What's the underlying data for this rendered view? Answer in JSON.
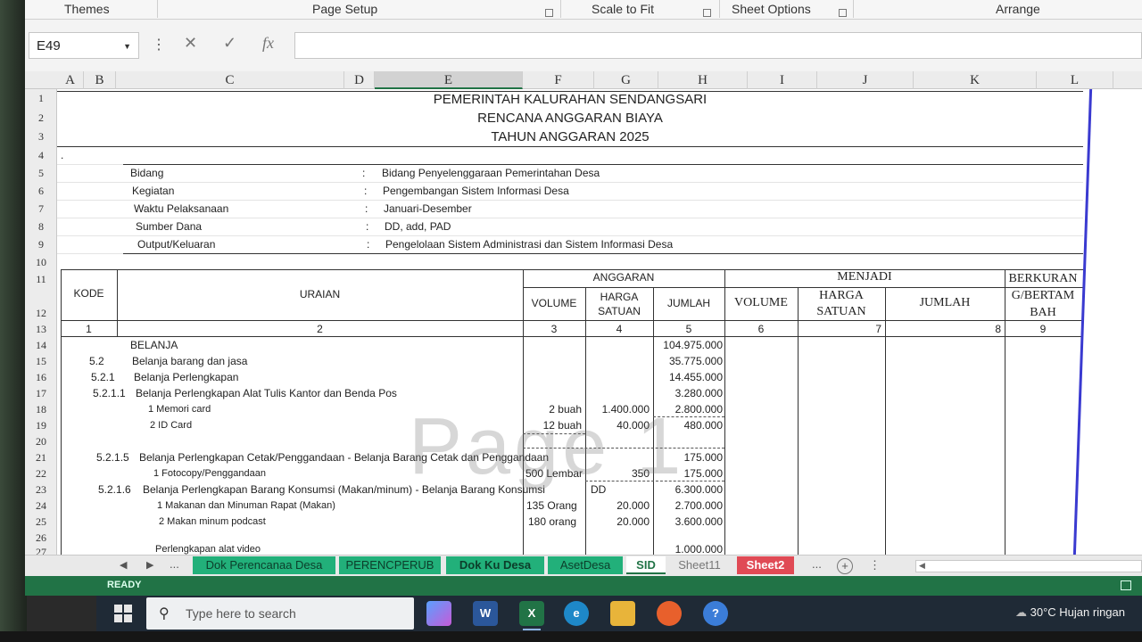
{
  "ribbon": {
    "groups": [
      "Themes",
      "Page Setup",
      "Scale to Fit",
      "Sheet Options",
      "Arrange"
    ]
  },
  "formula_bar": {
    "name_box": "E49",
    "dots": "⋮",
    "cancel": "✕",
    "enter": "✓",
    "fx": "fx",
    "value": ""
  },
  "columns": [
    "A",
    "B",
    "C",
    "D",
    "E",
    "F",
    "G",
    "H",
    "I",
    "J",
    "K",
    "L"
  ],
  "selected_column": "E",
  "rows": [
    "1",
    "2",
    "3",
    "4",
    "5",
    "6",
    "7",
    "8",
    "9",
    "10",
    "11",
    "12",
    "13",
    "14",
    "15",
    "16",
    "17",
    "18",
    "19",
    "20",
    "21",
    "22",
    "23",
    "24",
    "25",
    "26",
    "27"
  ],
  "title": {
    "line1": "PEMERINTAH KALURAHAN SENDANGSARI",
    "line2": "RENCANA ANGGARAN BIAYA",
    "line3": "TAHUN ANGGARAN 2025"
  },
  "row4_mark": ".",
  "info": [
    {
      "label": "Bidang",
      "sep": ":",
      "value": "Bidang Penyelenggaraan Pemerintahan Desa"
    },
    {
      "label": "Kegiatan",
      "sep": ":",
      "value": "Pengembangan Sistem Informasi Desa"
    },
    {
      "label": "Waktu Pelaksanaan",
      "sep": ":",
      "value": "Januari-Desember"
    },
    {
      "label": "Sumber Dana",
      "sep": ":",
      "value": "DD, add, PAD"
    },
    {
      "label": "Output/Keluaran",
      "sep": ":",
      "value": "Pengelolaan Sistem Administrasi dan Sistem Informasi Desa"
    }
  ],
  "headers": {
    "kode": "KODE",
    "uraian": "URAIAN",
    "anggaran": "ANGGARAN",
    "volume": "VOLUME",
    "harga_satuan_1": "HARGA",
    "harga_satuan_2": "SATUAN",
    "jumlah": "JUMLAH",
    "menjadi": "MENJADI",
    "volume2": "VOLUME",
    "harga2_1": "HARGA",
    "harga2_2": "SATUAN",
    "jumlah2": "JUMLAH",
    "berkurang_1": "BERKURAN",
    "berkurang_2": "G/BERTAM",
    "berkurang_3": "BAH"
  },
  "col_numbers": [
    "1",
    "2",
    "3",
    "4",
    "5",
    "6",
    "7",
    "8",
    "9"
  ],
  "items": [
    {
      "kode": "",
      "uraian": "BELANJA",
      "volume": "",
      "harga": "",
      "jumlah": "104.975.000"
    },
    {
      "kode": "5.2",
      "uraian": "Belanja barang dan jasa",
      "volume": "",
      "harga": "",
      "jumlah": "35.775.000"
    },
    {
      "kode": "5.2.1",
      "uraian": "Belanja Perlengkapan",
      "volume": "",
      "harga": "",
      "jumlah": "14.455.000"
    },
    {
      "kode": "5.2.1.1",
      "uraian": "Belanja Perlengkapan Alat Tulis Kantor dan Benda Pos",
      "volume": "",
      "harga": "",
      "jumlah": "3.280.000"
    },
    {
      "kode": "",
      "uraian": "1  Memori card",
      "volume": "2 buah",
      "harga": "1.400.000",
      "jumlah": "2.800.000"
    },
    {
      "kode": "",
      "uraian": "2  ID Card",
      "volume": "12 buah",
      "harga": "40.000",
      "jumlah": "480.000"
    },
    {
      "kode": "",
      "uraian": "",
      "volume": "",
      "harga": "",
      "jumlah": ""
    },
    {
      "kode": "5.2.1.5",
      "uraian": "Belanja Perlengkapan Cetak/Penggandaan - Belanja Barang Cetak dan Penggandaan",
      "volume": "",
      "harga": "",
      "jumlah": "175.000"
    },
    {
      "kode": "",
      "uraian": "1  Fotocopy/Penggandaan",
      "volume": "500 Lembar",
      "harga": "350",
      "jumlah": "175.000"
    },
    {
      "kode": "5.2.1.6",
      "uraian": "Belanja Perlengkapan Barang Konsumsi (Makan/minum) - Belanja Barang Konsumsi",
      "volume": "",
      "harga": "DD",
      "jumlah": "6.300.000"
    },
    {
      "kode": "",
      "uraian": "1  Makanan dan Minuman Rapat (Makan)",
      "volume": "135 Orang",
      "harga": "20.000",
      "jumlah": "2.700.000"
    },
    {
      "kode": "",
      "uraian": "2  Makan minum podcast",
      "volume": "180 orang",
      "harga": "20.000",
      "jumlah": "3.600.000"
    },
    {
      "kode": "",
      "uraian": "",
      "volume": "",
      "harga": "",
      "jumlah": ""
    },
    {
      "kode": "",
      "uraian": "Perlengkapan alat video",
      "volume": "",
      "harga": "",
      "jumlah": "1.000.000"
    }
  ],
  "watermark": "Page 1",
  "tabs": {
    "ellipsis_left": "...",
    "sheets": [
      "Dok Perencanaa Desa",
      "PERENCPERUB",
      "Dok Ku Desa",
      "AsetDesa",
      "SID",
      "Sheet11",
      "Sheet2"
    ],
    "ellipsis_right": "...",
    "add": "+"
  },
  "status": "READY",
  "taskbar": {
    "search_placeholder": "Type here to search",
    "apps": [
      "W",
      "X",
      "e",
      "folder",
      "firefox",
      "?"
    ],
    "weather": "30°C  Hujan ringan"
  }
}
